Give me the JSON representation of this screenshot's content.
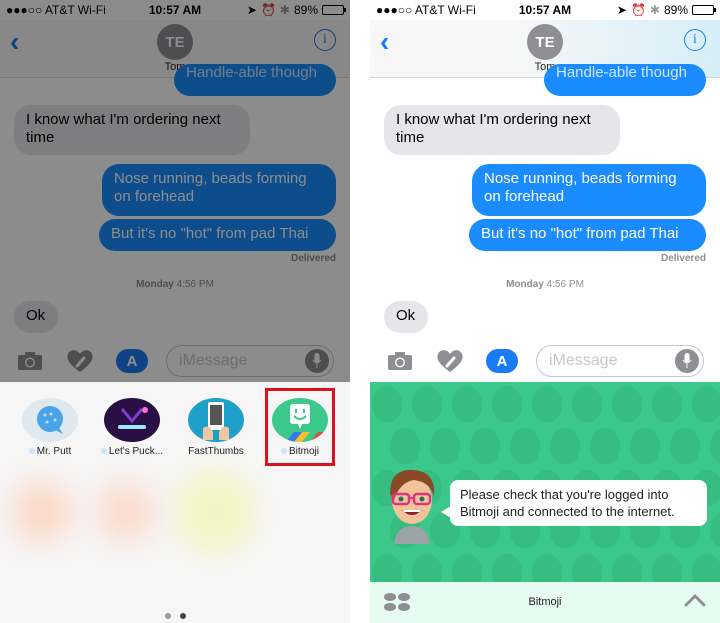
{
  "status_bar": {
    "carrier": "●●●○○ AT&T Wi-Fi",
    "time": "10:57 AM",
    "battery": "89%",
    "battery_level": 0.89
  },
  "nav": {
    "back_label": "‹",
    "avatar_initials": "TE",
    "contact_name": "Tom",
    "info_label": "i"
  },
  "thread": {
    "messages": [
      {
        "direction": "out",
        "text": "Handle-able though"
      },
      {
        "direction": "in",
        "text": "I know what I'm ordering next time"
      },
      {
        "direction": "out",
        "text": "Nose running, beads forming on forehead"
      },
      {
        "direction": "out",
        "text": "But it's no \"hot\" from pad Thai"
      },
      {
        "direction": "in",
        "text": "Ok"
      }
    ],
    "delivered": "Delivered",
    "timestamp_day": "Monday",
    "timestamp_time": "4:56 PM"
  },
  "input_bar": {
    "placeholder": "iMessage",
    "camera_icon": "camera-icon",
    "digital_touch_icon": "heart-hand-icon",
    "app_store_icon": "app-store-icon",
    "app_store_label": "A",
    "mic_icon": "microphone-icon"
  },
  "app_drawer": {
    "apps": [
      {
        "name": "Mr. Putt",
        "icon": "golf-ball-icon",
        "color": "#4aa3e8"
      },
      {
        "name": "Let's Puck...",
        "icon": "puck-icon",
        "color": "#2a0f45"
      },
      {
        "name": "FastThumbs",
        "icon": "phone-hands-icon",
        "color": "#1ea0c8"
      },
      {
        "name": "Bitmoji",
        "icon": "bitmoji-icon",
        "color": "#3bc88a"
      }
    ],
    "highlighted_app": "Bitmoji",
    "highlight_color": "#e0111b",
    "page_count": 2,
    "current_page": 2
  },
  "bitmoji": {
    "message": "Please check that you're logged into Bitmoji and connected to the internet.",
    "footer_title": "Bitmoji",
    "bg_color": "#3bc88a"
  }
}
